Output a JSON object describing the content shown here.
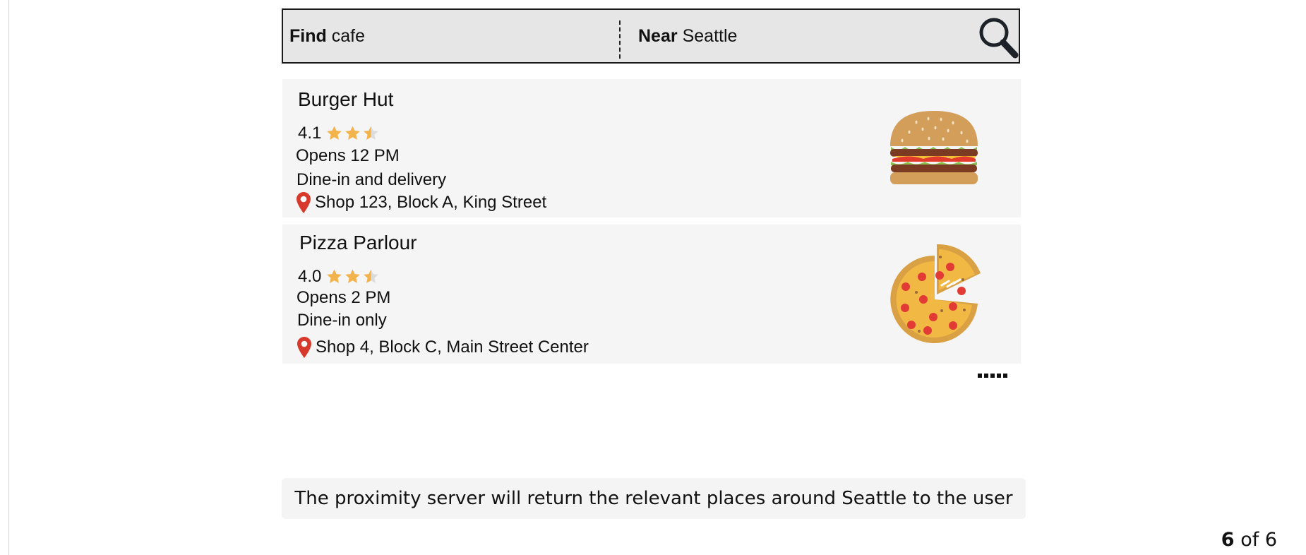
{
  "search": {
    "find_label": "Find",
    "find_value": "cafe",
    "near_label": "Near",
    "near_value": "Seattle",
    "icon": "search-icon"
  },
  "results": [
    {
      "name": "Burger Hut",
      "rating": "4.1",
      "rating_stars": 2.5,
      "hours": "Opens 12 PM",
      "service": "Dine-in and delivery",
      "address": "Shop 123, Block A, King Street",
      "image_icon": "burger-icon"
    },
    {
      "name": "Pizza Parlour",
      "rating": "4.0",
      "rating_stars": 2.5,
      "hours": "Opens 2 PM",
      "service": "Dine-in only",
      "address": "Shop 4, Block C, Main Street Center",
      "image_icon": "pizza-icon"
    }
  ],
  "more_icon": "more-dots-icon",
  "caption": "The proximity server will return the relevant places around Seattle to the user",
  "pagination": {
    "current": "6",
    "separator": "of",
    "total": "6"
  },
  "colors": {
    "star": "#f2b24c",
    "star_empty": "#dcdcdc",
    "pin": "#d73a2c",
    "search_bar_bg": "#e6e6e6",
    "card_bg": "#f5f5f5"
  }
}
